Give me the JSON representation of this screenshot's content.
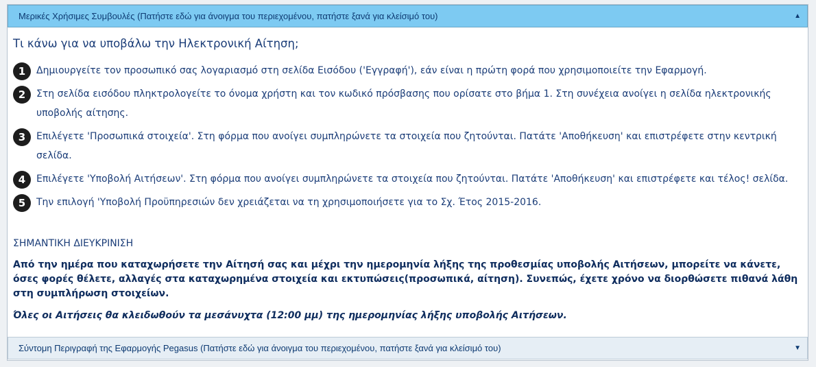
{
  "accordion": {
    "open_header": "Μερικές Χρήσιμες Συμβουλές (Πατήστε εδώ για άνοιγμα του περιεχομένου, πατήστε ξανά για κλείσιμό του)",
    "open_arrow": "▲",
    "closed_header": "Σύντομη Περιγραφή της Εφαρμογής Pegasus (Πατήστε εδώ για άνοιγμα του περιεχομένου, πατήστε ξανά για κλείσιμό του)",
    "closed_arrow": "▼"
  },
  "content": {
    "heading": "Τι κάνω για να υποβάλω την Ηλεκτρονική Αίτηση;",
    "steps": [
      {
        "num": "1",
        "text": "Δημιουργείτε τον προσωπικό σας λογαριασμό στη σελίδα Εισόδου ('Εγγραφή'), εάν είναι η πρώτη φορά που χρησιμοποιείτε την Εφαρμογή."
      },
      {
        "num": "2",
        "text": "Στη σελίδα εισόδου πληκτρολογείτε το όνομα χρήστη και τον κωδικό πρόσβασης που ορίσατε στο βήμα 1. Στη συνέχεια ανοίγει η σελίδα ηλεκτρονικής υποβολής αίτησης."
      },
      {
        "num": "3",
        "text": "Επιλέγετε 'Προσωπικά στοιχεία'. Στη φόρμα που ανοίγει συμπληρώνετε τα στοιχεία που ζητούνται. Πατάτε 'Αποθήκευση' και επιστρέφετε στην κεντρική σελίδα."
      },
      {
        "num": "4",
        "text": "Επιλέγετε 'Υποβολή Αιτήσεων'. Στη φόρμα που ανοίγει συμπληρώνετε τα στοιχεία που ζητούνται. Πατάτε 'Αποθήκευση' και επιστρέφετε και τέλος! σελίδα."
      },
      {
        "num": "5",
        "text": "Την επιλογή 'Υποβολή Προϋπηρεσιών δεν χρειάζεται να τη χρησιμοποιήσετε για το Σχ. Έτος 2015-2016."
      }
    ],
    "note_title": "ΣΗΜΑΝΤΙΚΗ ΔΙΕΥΚΡΙΝΙΣΗ",
    "note_bold": "Από την ημέρα που καταχωρήσετε την Αίτησή σας και μέχρι την ημερομηνία λήξης της προθεσμίας υποβολής Αιτήσεων, μπορείτε να κάνετε, όσες φορές θέλετε, αλλαγές στα καταχωρημένα στοιχεία και εκτυπώσεις(προσωπικά, αίτηση). Συνεπώς, έχετε χρόνο να διορθώσετε πιθανά λάθη στη συμπλήρωση στοιχείων.",
    "note_italic": "Όλες οι Αιτήσεις θα κλειδωθούν τα μεσάνυχτα (12:00 μμ) της ημερομηνίας λήξης υποβολής Αιτήσεων."
  }
}
